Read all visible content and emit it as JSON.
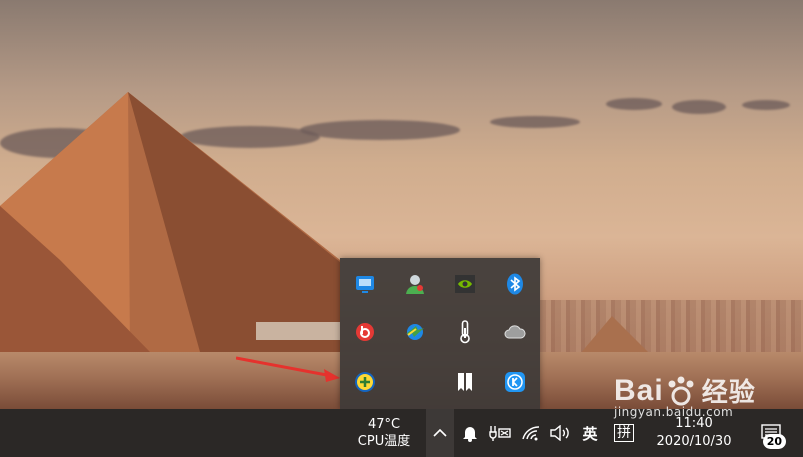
{
  "tray": {
    "icons": [
      {
        "name": "monitor-app-icon",
        "color": "#1e88e5"
      },
      {
        "name": "user-avatar-icon",
        "color": "#8bc34a"
      },
      {
        "name": "nvidia-icon",
        "color": "#76b900"
      },
      {
        "name": "bluetooth-icon",
        "color": "#1e88e5"
      },
      {
        "name": "beats-icon",
        "color": "#e53935"
      },
      {
        "name": "download-manager-icon",
        "color": "#43a047"
      },
      {
        "name": "thermometer-icon",
        "color": "#ffffff"
      },
      {
        "name": "cloud-icon",
        "color": "#bdbdbd"
      },
      {
        "name": "add-app-icon",
        "color": "#fdd835"
      },
      {
        "name": "bookmark-app-icon",
        "color": "#ffffff"
      },
      {
        "name": "k-app-icon",
        "color": "#2196f3"
      }
    ]
  },
  "taskbar": {
    "cpu_temp_value": "47°C",
    "cpu_temp_label": "CPU温度",
    "language": "英",
    "ime": "拼",
    "time": "11:40",
    "date": "2020/10/30",
    "notification_count": "20"
  },
  "watermark": {
    "brand": "Bai",
    "brand_suffix": "经验",
    "url": "jingyan.baidu.com"
  }
}
